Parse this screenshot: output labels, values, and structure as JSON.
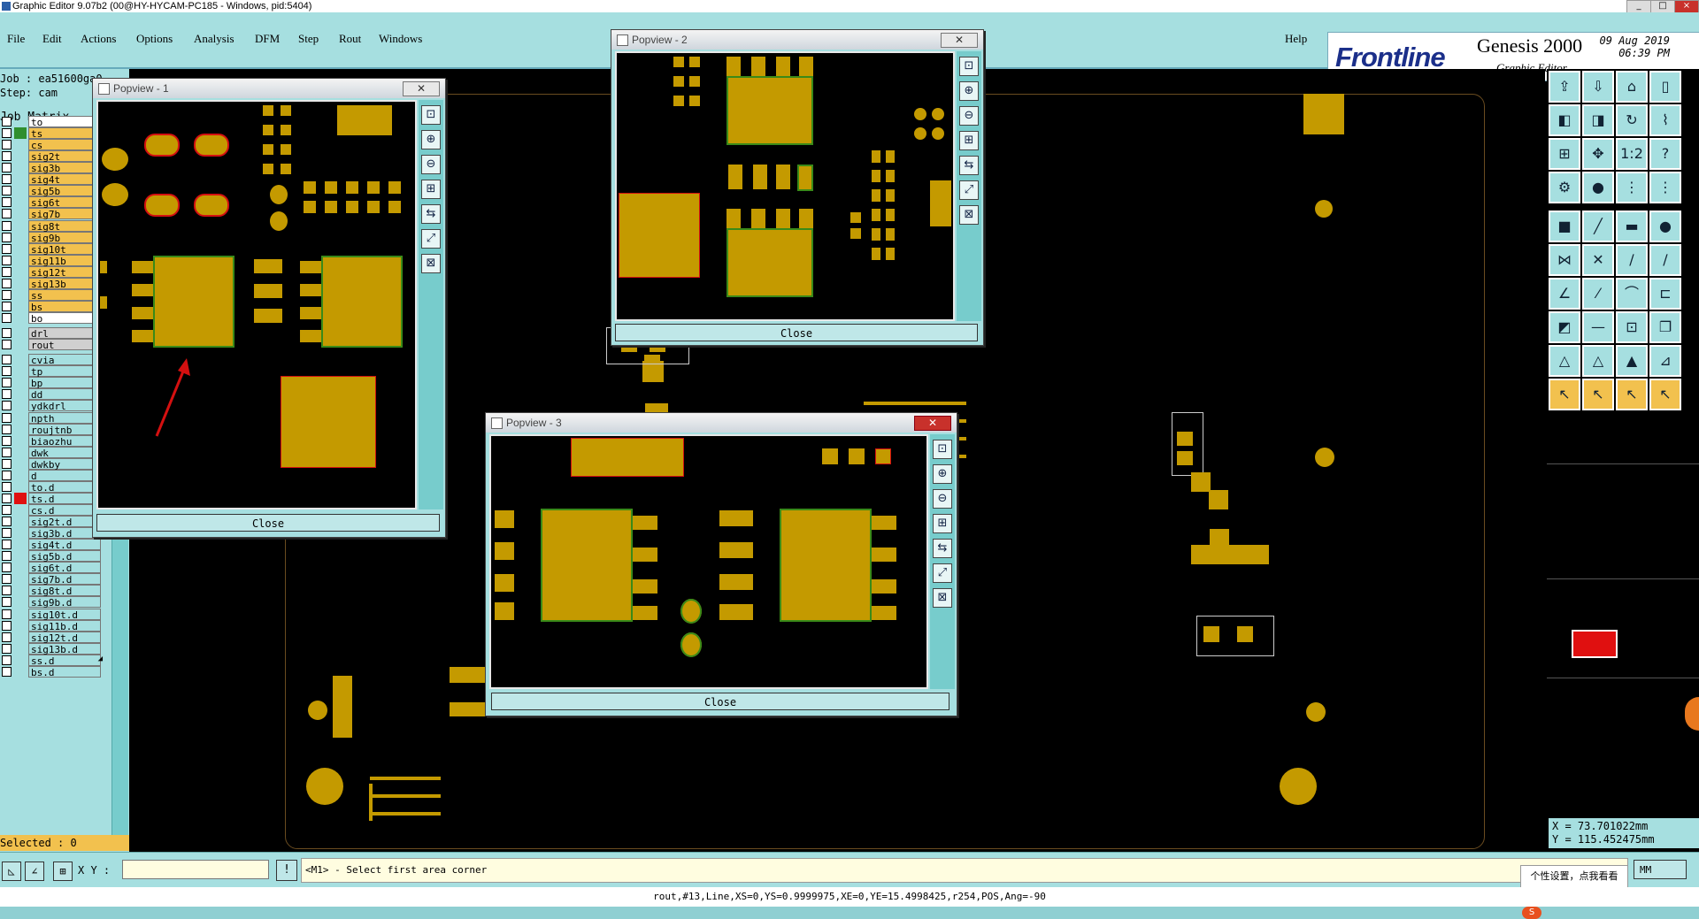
{
  "window": {
    "title": "Graphic Editor 9.07b2 (00@HY-HYCAM-PC185 - Windows, pid:5404)",
    "min": "_",
    "max": "□",
    "close": "×"
  },
  "menu": {
    "file": "File",
    "edit": "Edit",
    "actions": "Actions",
    "options": "Options",
    "analysis": "Analysis",
    "dfm": "DFM",
    "step": "Step",
    "rout": "Rout",
    "windows": "Windows",
    "help": "Help"
  },
  "brand": {
    "logo": "Frontline",
    "product": "Genesis 2000",
    "subtitle": "Graphic Editor",
    "date": "09 Aug 2019",
    "time": "06:39 PM"
  },
  "job": {
    "job_line": "Job : ea51600ga0",
    "step_line": "Step: cam",
    "matrix_button": "Job Matrix .."
  },
  "layers": [
    {
      "name": "to",
      "bg": "#ffffff",
      "swatch": "",
      "tri": "◢"
    },
    {
      "name": "ts",
      "bg": "#f2c14e",
      "swatch": "#2f8f2f",
      "tri": ""
    },
    {
      "name": "cs",
      "bg": "#f2c14e",
      "swatch": "",
      "tri": "◢"
    },
    {
      "name": "sig2t",
      "bg": "#f2c14e",
      "swatch": "",
      "tri": ""
    },
    {
      "name": "sig3b",
      "bg": "#f2c14e",
      "swatch": "",
      "tri": ""
    },
    {
      "name": "sig4t",
      "bg": "#f2c14e",
      "swatch": "",
      "tri": ""
    },
    {
      "name": "sig5b",
      "bg": "#f2c14e",
      "swatch": "",
      "tri": ""
    },
    {
      "name": "sig6t",
      "bg": "#f2c14e",
      "swatch": "",
      "tri": ""
    },
    {
      "name": "sig7b",
      "bg": "#f2c14e",
      "swatch": "",
      "tri": ""
    },
    {
      "name": "sig8t",
      "bg": "#f2c14e",
      "swatch": "",
      "tri": ""
    },
    {
      "name": "sig9b",
      "bg": "#f2c14e",
      "swatch": "",
      "tri": ""
    },
    {
      "name": "sig10t",
      "bg": "#f2c14e",
      "swatch": "",
      "tri": ""
    },
    {
      "name": "sig11b",
      "bg": "#f2c14e",
      "swatch": "",
      "tri": ""
    },
    {
      "name": "sig12t",
      "bg": "#f2c14e",
      "swatch": "",
      "tri": ""
    },
    {
      "name": "sig13b",
      "bg": "#f2c14e",
      "swatch": "",
      "tri": ""
    },
    {
      "name": "ss",
      "bg": "#f2c14e",
      "swatch": "",
      "tri": "◢"
    },
    {
      "name": "bs",
      "bg": "#f2c14e",
      "swatch": "",
      "tri": ""
    },
    {
      "name": "bo",
      "bg": "#ffffff",
      "swatch": "",
      "tri": "◢"
    },
    {
      "name": "drl",
      "bg": "#d0d0d0",
      "swatch": "",
      "tri": ""
    },
    {
      "name": "rout",
      "bg": "#d0d0d0",
      "swatch": "",
      "tri": ""
    },
    {
      "name": "cvia",
      "bg": "#a6dfe0",
      "swatch": "",
      "tri": ""
    },
    {
      "name": "tp",
      "bg": "#a6dfe0",
      "swatch": "",
      "tri": ""
    },
    {
      "name": "bp",
      "bg": "#a6dfe0",
      "swatch": "",
      "tri": ""
    },
    {
      "name": "dd",
      "bg": "#a6dfe0",
      "swatch": "",
      "tri": ""
    },
    {
      "name": "ydkdrl",
      "bg": "#a6dfe0",
      "swatch": "",
      "tri": ""
    },
    {
      "name": "npth",
      "bg": "#a6dfe0",
      "swatch": "",
      "tri": ""
    },
    {
      "name": "roujtnb",
      "bg": "#a6dfe0",
      "swatch": "",
      "tri": ""
    },
    {
      "name": "biaozhu",
      "bg": "#a6dfe0",
      "swatch": "",
      "tri": ""
    },
    {
      "name": "dwk",
      "bg": "#a6dfe0",
      "swatch": "",
      "tri": ""
    },
    {
      "name": "dwkby",
      "bg": "#a6dfe0",
      "swatch": "",
      "tri": ""
    },
    {
      "name": "d",
      "bg": "#a6dfe0",
      "swatch": "",
      "tri": ""
    },
    {
      "name": "to.d",
      "bg": "#a6dfe0",
      "swatch": "",
      "tri": "◢"
    },
    {
      "name": "ts.d",
      "bg": "#a6dfe0",
      "swatch": "#e01010",
      "tri": "◢"
    },
    {
      "name": "cs.d",
      "bg": "#a6dfe0",
      "swatch": "",
      "tri": "◢"
    },
    {
      "name": "sig2t.d",
      "bg": "#a6dfe0",
      "swatch": "",
      "tri": ""
    },
    {
      "name": "sig3b.d",
      "bg": "#a6dfe0",
      "swatch": "",
      "tri": ""
    },
    {
      "name": "sig4t.d",
      "bg": "#a6dfe0",
      "swatch": "",
      "tri": ""
    },
    {
      "name": "sig5b.d",
      "bg": "#a6dfe0",
      "swatch": "",
      "tri": ""
    },
    {
      "name": "sig6t.d",
      "bg": "#a6dfe0",
      "swatch": "",
      "tri": ""
    },
    {
      "name": "sig7b.d",
      "bg": "#a6dfe0",
      "swatch": "",
      "tri": ""
    },
    {
      "name": "sig8t.d",
      "bg": "#a6dfe0",
      "swatch": "",
      "tri": ""
    },
    {
      "name": "sig9b.d",
      "bg": "#a6dfe0",
      "swatch": "",
      "tri": ""
    },
    {
      "name": "sig10t.d",
      "bg": "#a6dfe0",
      "swatch": "",
      "tri": ""
    },
    {
      "name": "sig11b.d",
      "bg": "#a6dfe0",
      "swatch": "",
      "tri": ""
    },
    {
      "name": "sig12t.d",
      "bg": "#a6dfe0",
      "swatch": "",
      "tri": ""
    },
    {
      "name": "sig13b.d",
      "bg": "#a6dfe0",
      "swatch": "",
      "tri": ""
    },
    {
      "name": "ss.d",
      "bg": "#a6dfe0",
      "swatch": "",
      "tri": "◢"
    },
    {
      "name": "bs.d",
      "bg": "#a6dfe0",
      "swatch": "",
      "tri": ""
    }
  ],
  "selected": "Selected : 0",
  "popups": {
    "p1": {
      "title": "Popview - 1",
      "close": "Close"
    },
    "p2": {
      "title": "Popview - 2",
      "close": "Close"
    },
    "p3": {
      "title": "Popview - 3",
      "close": "Close"
    }
  },
  "command": {
    "xy_label": "X Y :",
    "xy_value": "",
    "prompt": "<M1> - Select first area corner",
    "units": "MM"
  },
  "coords": {
    "x": "X = 73.701022mm",
    "y": "Y = 115.452475mm"
  },
  "tooltip": "个性设置，点我看看",
  "status": "rout,#13,Line,XS=0,YS=0.9999975,XE=0,YE=15.4998425,r254,POS,Ang=-90",
  "colors": {
    "panel": "#a6dfe0",
    "layer_board": "#f2c14e",
    "copper": "#c49a00",
    "highlight": "#d41010",
    "mask": "#3a8a18"
  }
}
